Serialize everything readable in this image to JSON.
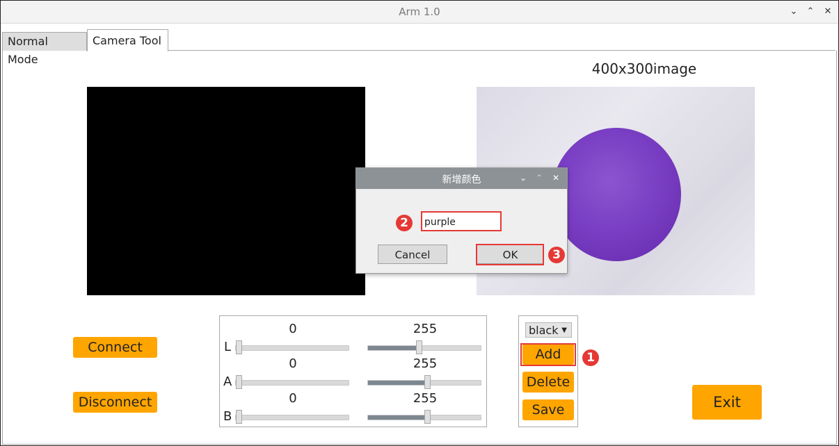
{
  "window": {
    "title": "Arm 1.0",
    "controls": {
      "minimize": "⌄",
      "maximize": "⌃",
      "close": "✕"
    }
  },
  "tabs": [
    {
      "label": "Normal Mode"
    },
    {
      "label": "Camera Tool"
    }
  ],
  "image_label": "400x300image",
  "buttons": {
    "connect": "Connect",
    "disconnect": "Disconnect",
    "exit": "Exit"
  },
  "sliders": [
    {
      "label": "L",
      "min_value": "0",
      "max_value": "255",
      "min_level": 0,
      "max_level": 0.45
    },
    {
      "label": "A",
      "min_value": "0",
      "max_value": "255",
      "min_level": 0,
      "max_level": 0.53
    },
    {
      "label": "B",
      "min_value": "0",
      "max_value": "255",
      "min_level": 0,
      "max_level": 0.53
    }
  ],
  "color_panel": {
    "selected": "black",
    "add": "Add",
    "delete": "Delete",
    "save": "Save"
  },
  "dialog": {
    "title": "新增颜色",
    "input_value": "purple",
    "cancel": "Cancel",
    "ok": "OK"
  },
  "annotations": {
    "step1": "1",
    "step2": "2",
    "step3": "3"
  },
  "colors": {
    "accent_orange": "#ffa500",
    "annotation_red": "#e53935",
    "dialog_title_bg": "#8d9296"
  }
}
